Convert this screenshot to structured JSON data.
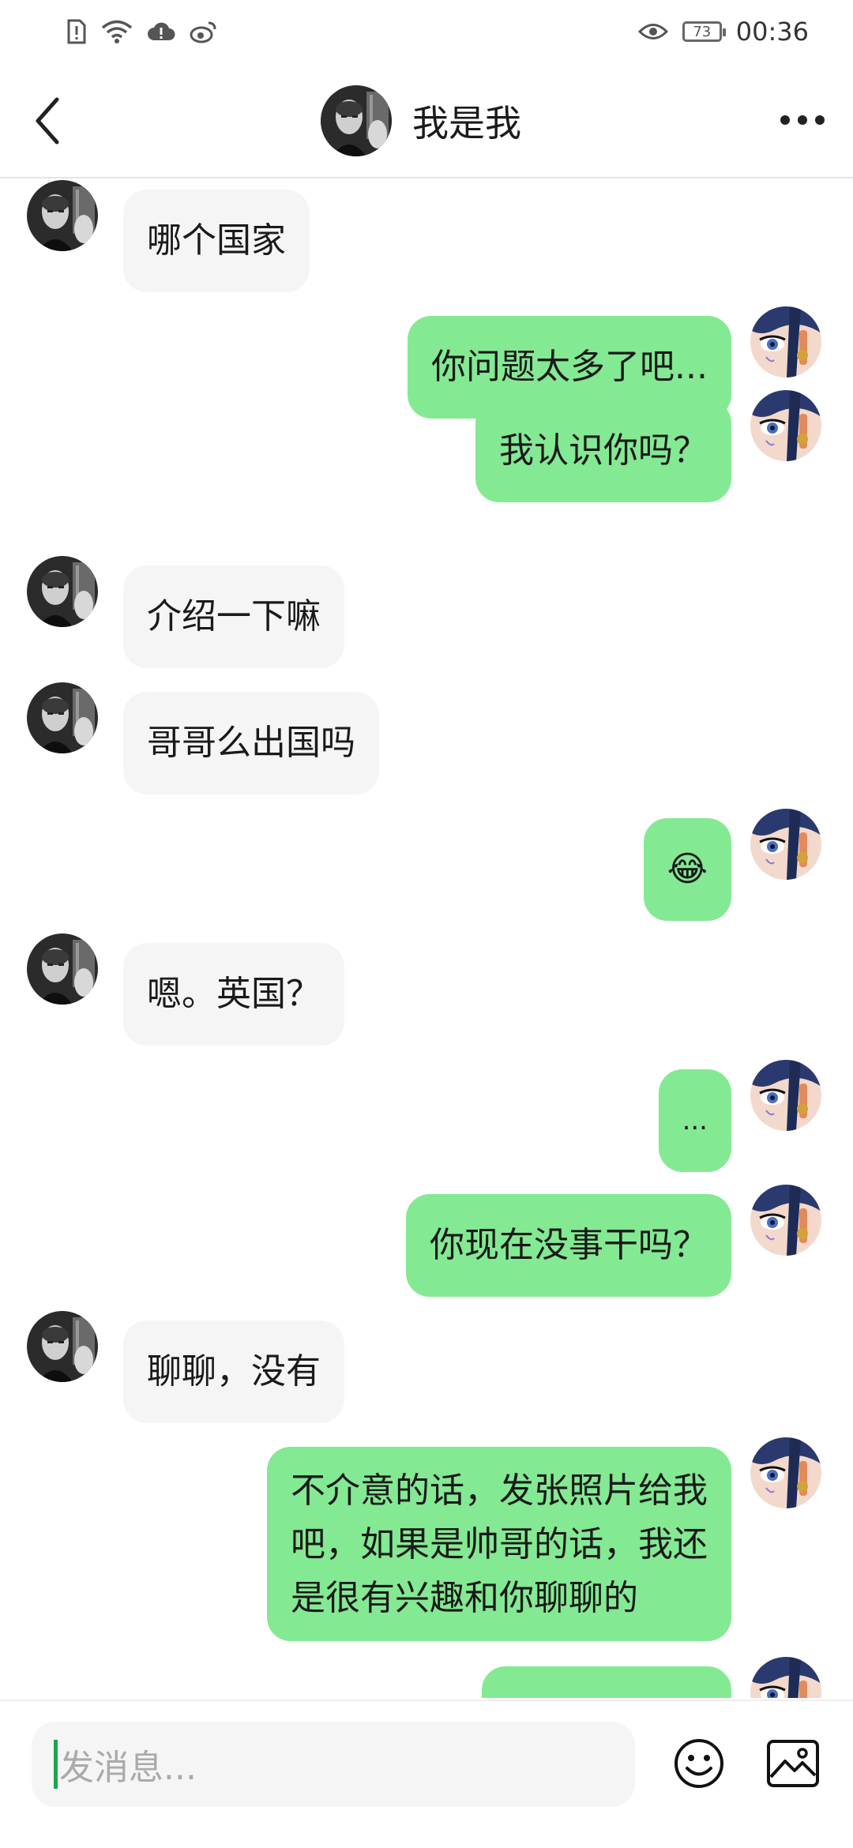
{
  "status_bar": {
    "battery": "73",
    "time": "00:36",
    "icons": [
      "sim-alert-icon",
      "wifi-icon",
      "cloud-alert-icon",
      "weibo-icon",
      "eye-icon"
    ]
  },
  "header": {
    "title": "我是我",
    "back_icon": "chevron-left-icon",
    "more_icon": "more-dots-icon"
  },
  "messages": [
    {
      "side": "left",
      "text": "哪个国家"
    },
    {
      "side": "right",
      "text": "你问题太多了吧..."
    },
    {
      "side": "right",
      "text": "我认识你吗？"
    },
    {
      "side": "left",
      "text": "介绍一下嘛"
    },
    {
      "side": "left",
      "text": "哥哥么出国吗"
    },
    {
      "side": "right",
      "text": "😂"
    },
    {
      "side": "left",
      "text": "嗯。英国？"
    },
    {
      "side": "right",
      "text": "..."
    },
    {
      "side": "right",
      "text": "你现在没事干吗？"
    },
    {
      "side": "left",
      "text": "聊聊，没有"
    },
    {
      "side": "right",
      "text": "不介意的话，发张照片给我\n吧，如果是帅哥的话，我还\n是很有兴趣和你聊聊的"
    },
    {
      "side": "right",
      "text": ""
    }
  ],
  "input": {
    "placeholder": "发消息..."
  },
  "colors": {
    "incoming_bubble": "#f5f5f5",
    "outgoing_bubble": "#84e993",
    "caret": "#1aa84a"
  }
}
